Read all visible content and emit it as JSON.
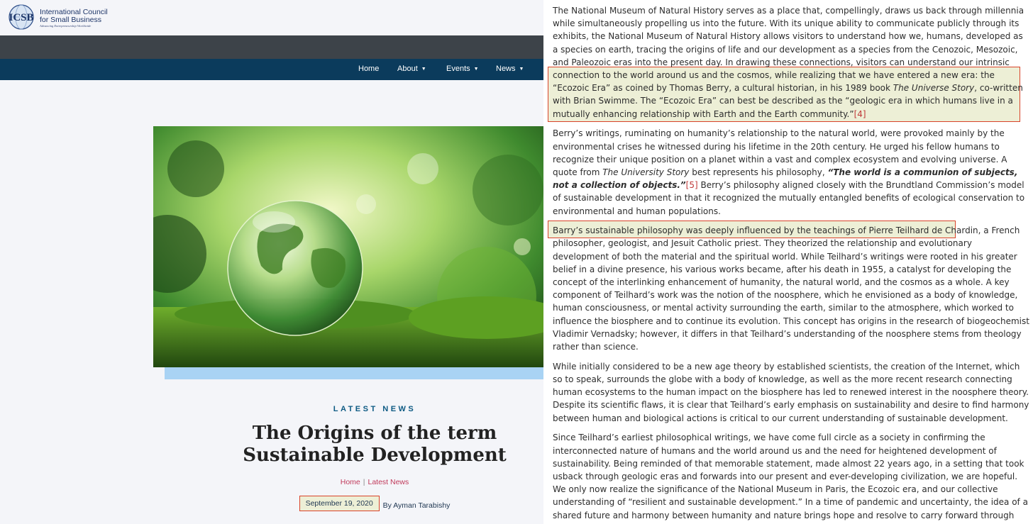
{
  "site": {
    "logo_abbr": "ICSB",
    "logo_line1": "International Council",
    "logo_line2": "for Small Business",
    "logo_tagline": "Advancing Entrepreneurship Worldwide"
  },
  "nav": {
    "items": [
      {
        "label": "Home",
        "has_caret": false
      },
      {
        "label": "About",
        "has_caret": true
      },
      {
        "label": "Events",
        "has_caret": true
      },
      {
        "label": "News",
        "has_caret": true
      }
    ],
    "caret": "▼"
  },
  "post": {
    "category": "LATEST NEWS",
    "title": "The Origins of the term Sustainable Development",
    "breadcrumb": [
      "Home",
      "Latest News"
    ],
    "breadcrumb_sep": "|",
    "date": "September 19, 2020",
    "author": "By Ayman Tarabishy"
  },
  "article": {
    "p1_a": "The National Museum of Natural History serves as a place that, compellingly, draws us back through millennia while simultaneously propelling us into the future. With its unique ability to communicate publicly through its exhibits, the National Museum of Natural History allows visitors to understand how we, humans, developed as a species on earth, tracing the origins of life and our development as a species from the Cenozoic, Mesozoic, and Paleozoic eras into the present day. In drawing these connections, visitors can understand our intrinsic connection to the world ",
    "p1_hl_a": "around us and the cosmos, while realizing that we have entered a new era: the “Ecozoic Era” as coined by Thomas Berry, a cultural historian, in his 1989 book ",
    "p1_hl_book": "The Universe Story",
    "p1_hl_b": ", co-written with Brian Swimme. The “Ecozoic Era” can best be described as the “geologic era in which humans live in a mutually enhancing relationship with Earth and the Earth community.”",
    "p1_ref": "[4]",
    "p2_a": "Berry’s writings, ruminating on humanity’s relationship to the natural world, were provoked mainly by the environmental crises he witnessed during his lifetime in the 20th century. He urged his fellow humans to recognize their unique position on a planet within a vast and complex ecosystem and evolving universe. A quote from ",
    "p2_book": "The University Story",
    "p2_b": " best represents his philosophy, ",
    "p2_quote": "“The world is a communion of subjects, not a collection of objects.”",
    "p2_ref": "[5]",
    "p2_c": " Berry’s philosophy aligned closely with the Brundtland Commission’s model of sustainable development in that it recognized the mutually entangled benefits of ecological conservation to environmental and human populations.",
    "p3_hl": "Barry’s sustainable philosophy was deeply influenced by the teachings of Pierre Teilhard de Chardin,",
    "p3_rest": " a French philosopher, geologist, and Jesuit Catholic priest. They theorized the relationship and evolutionary development of both the material and the spiritual world. While Teilhard’s writings were rooted in his greater belief in a divine presence, his various works became, after his death in 1955, a catalyst for developing the concept of the interlinking enhancement of humanity, the natural world, and the cosmos as a whole. A key component of Teilhard’s work was the notion of the noosphere, which he envisioned as a body of knowledge, human consciousness, or mental activity surrounding the earth, similar to the atmosphere, which worked to influence the biosphere and to continue its evolution. This concept has origins in the research of biogeochemist Vladimir Vernadsky; however, it differs in that Teilhard’s understanding of the noosphere stems from theology rather than science.",
    "p4": "While initially considered to be a new age theory by established scientists, the creation of the Internet, which so to speak, surrounds the globe with a body of knowledge, as well as the more recent research connecting human ecosystems to the human impact on the biosphere has led to renewed interest in the noosphere theory. Despite its scientific flaws, it is clear that Teilhard’s early emphasis on sustainability and desire to find harmony between human and biological actions is critical to our current understanding of sustainable development.",
    "p5": "Since Teilhard’s earliest philosophical writings, we have come full circle as a society in confirming the interconnected nature of humans and the world around us and the need for heightened development of sustainability. Being reminded of that memorable statement, made almost 22 years ago, in a setting that took usback through geologic eras and forwards into our present and ever-developing civilization, we are hopeful. We only now realize the significance of the National Museum in Paris, the Ecozoic era, and our collective understanding of “resilient and sustainable development.” In a time of pandemic and uncertainty, the idea of a shared future and harmony between humanity and nature brings hope and resolve to carry forward through our efforts towards sustainable development."
  },
  "colors": {
    "nav_bg": "#0b3b5c",
    "dark_bar": "#3d4349",
    "highlight_border": "#d9432a",
    "highlight_fill": "#edefd6",
    "link_red": "#c03a5b",
    "category_blue": "#0d5a83"
  }
}
